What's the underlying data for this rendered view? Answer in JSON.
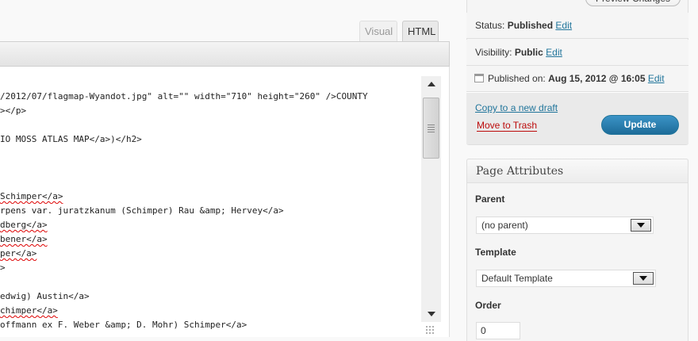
{
  "editor": {
    "tabs": [
      {
        "label": "Visual",
        "active": false
      },
      {
        "label": "HTML",
        "active": true
      }
    ],
    "code_lines": [
      "/2012/07/flagmap-Wyandot.jpg\" alt=\"\" width=\"710\" height=\"260\" />COUNTY",
      "></p>",
      "",
      "IO MOSS ATLAS MAP</a>)</h2>",
      "",
      "",
      "",
      "Schimper</a>",
      "rpens var. juratzkanum (Schimper) Rau &amp; Hervey</a>",
      "dberg</a>",
      "bener</a>",
      "per</a>",
      ">",
      "",
      "edwig) Austin</a>",
      "chimper</a>",
      "offmann ex F. Weber &amp; D. Mohr) Schimper</a>"
    ]
  },
  "publish": {
    "preview_label": "Preview Changes",
    "status_label": "Status:",
    "status_value": "Published",
    "visibility_label": "Visibility:",
    "visibility_value": "Public",
    "published_label": "Published on:",
    "published_value": "Aug 15, 2012 @ 16:05",
    "edit_label": "Edit",
    "copy_label": "Copy to a new draft",
    "trash_label": "Move to Trash",
    "update_label": "Update"
  },
  "page_attributes": {
    "title": "Page Attributes",
    "parent_label": "Parent",
    "parent_value": "(no parent)",
    "template_label": "Template",
    "template_value": "Default Template",
    "order_label": "Order",
    "order_value": "0"
  },
  "colors": {
    "link": "#21759b",
    "trash": "#bc0b0b",
    "update_button": "#2a80b0"
  }
}
